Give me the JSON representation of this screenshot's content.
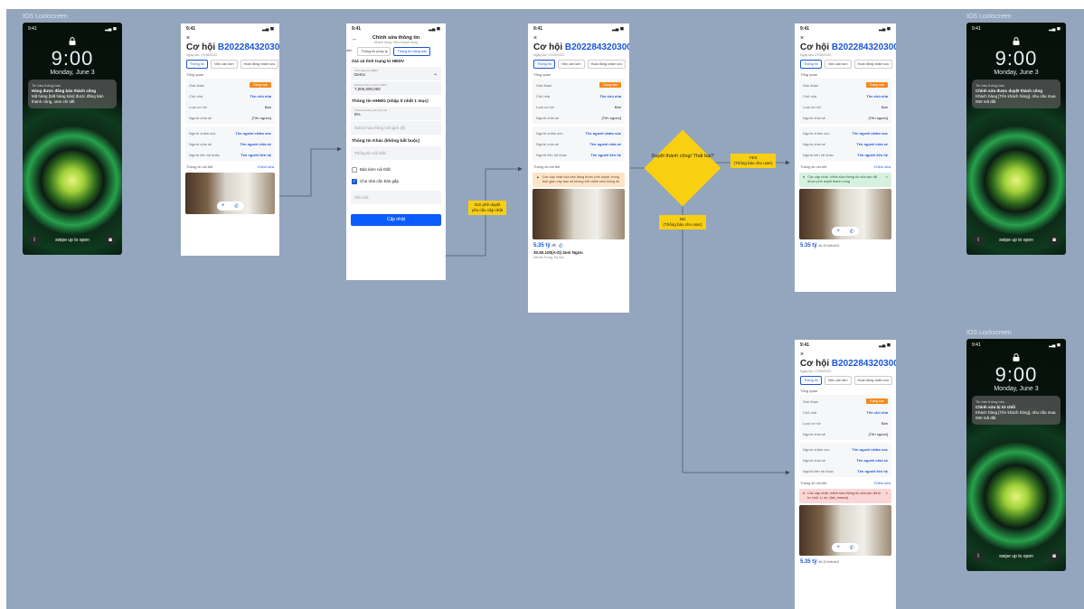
{
  "lockscreens": [
    {
      "label": "IOS Lockscreen",
      "time": "9:00",
      "date": "Monday, June 3",
      "status_time": "9:41",
      "notif_app": "Tin báo thông báo",
      "notif_title": "Hàng được đăng bán thành công",
      "notif_body": "Mã hàng [Mã hàng bán] được đăng bán thành công, xem chi tiết",
      "swipe": "swipe up to open"
    },
    {
      "label": "IOS Lockscreen",
      "time": "9:00",
      "date": "Monday, June 3",
      "status_time": "9:41",
      "notif_app": "Tin báo thông báo",
      "notif_title": "Chỉnh sửa được duyệt thành công",
      "notif_body": "Khách hàng [Tên khách hàng], nhu cầu mua 000 mã đất",
      "swipe": "swipe up to open"
    },
    {
      "label": "IOS Lockscreen",
      "time": "9:00",
      "date": "Monday, June 3",
      "status_time": "9:41",
      "notif_app": "Tin báo thông báo",
      "notif_title": "Chỉnh sửa bị từ chối",
      "notif_body": "Khách hàng [Tên khách hàng], nhu cầu mua 000 mã đất",
      "swipe": "swipe up to open"
    }
  ],
  "detail": {
    "status_time": "9:41",
    "close": "×",
    "title_prefix": "Cơ hội",
    "code": "B2022843203006",
    "created": "Ngày tạo: 07/06/2022",
    "tabs": [
      "Thông tin",
      "Việc cần làm",
      "Hoạt động chăm sóc"
    ],
    "overview": "Tổng quan",
    "rows1": [
      [
        "Giai đoạn",
        "Đang bán"
      ],
      [
        "Chủ nhà",
        "Tên chủ nhà"
      ],
      [
        "Loại cơ hội",
        "Bán"
      ],
      [
        "Người chia sẻ",
        "[Tên nguồn]"
      ]
    ],
    "rows2": [
      [
        "Người chăm sóc",
        "Tên người chăm sóc"
      ],
      [
        "Người chia sẻ",
        "Tên người chia sẻ"
      ],
      [
        "Người liên hệ khác",
        "Tên người liên hệ"
      ]
    ],
    "detail_title": "Thông tin chi tiết",
    "edit": "Chỉnh sửa",
    "price": "5.35 tỷ",
    "price_unit": "46.15 triệu/m2",
    "address": "30.50.100(A-D) 4nm Ngưu",
    "location": "Hai Bà Trưng, Hà Nội",
    "alert_pending": "Các cập nhật của bạn đang được phê duyệt, trong thời gian này bạn sẽ không thể chỉnh sửa thông tin",
    "alert_ok": "Các cập nhật, chỉnh sửa thông tin của bạn đã được phê duyệt thành công",
    "alert_err": "Các cập nhật, chỉnh sửa thông tin của bạn đã bị từ chối. Lí do: [fail_reason]"
  },
  "edit": {
    "status_time": "9:41",
    "title": "Chỉnh sửa thông tin",
    "subtitle": "Khách hàng: Kiều Khánh Hùng",
    "tabs": [
      "anh",
      "Thông tin pháp lý",
      "Thông tin hàng bán"
    ],
    "sec1": "Giá và tình trạng kí HĐDV",
    "f1_label": "Tình trạng kí HĐDV",
    "f1_value": "Demo",
    "f2_label": "Giá bán (đơn vị tính: VND)",
    "f2_value": "7,000,000,000",
    "sec2": "Thông tin HHMG (nhập ít nhất 1 mục)",
    "f3_label": "Tỉ lệ hoa hồng môi giới (%)",
    "f3_value": "5%",
    "f4_placeholder": "Giá trị hoa hồng môi giới (đ)",
    "sec3": "Thông tin Khác (không bắt buộc)",
    "f5_placeholder": "Thông tin nội thất",
    "chk1": "Bán kèm nội thất",
    "chk2": "Chủ nhà cần bán gấp",
    "note_placeholder": "Ghi chú",
    "submit": "Cập nhật"
  },
  "flow": {
    "send_label": "Gửi phê duyệt yêu cầu cập nhật",
    "decision": "Duyệt thành công/ Thất bại?",
    "yes": "YES",
    "yes_note": "(Thông báo cho user)",
    "no": "NO",
    "no_note": "(Thông báo cho user)"
  },
  "colors": {
    "canvas": "#94a6bd",
    "accent": "#1a56d8",
    "decision": "#f9cf12",
    "badge": "#f28a1e"
  }
}
